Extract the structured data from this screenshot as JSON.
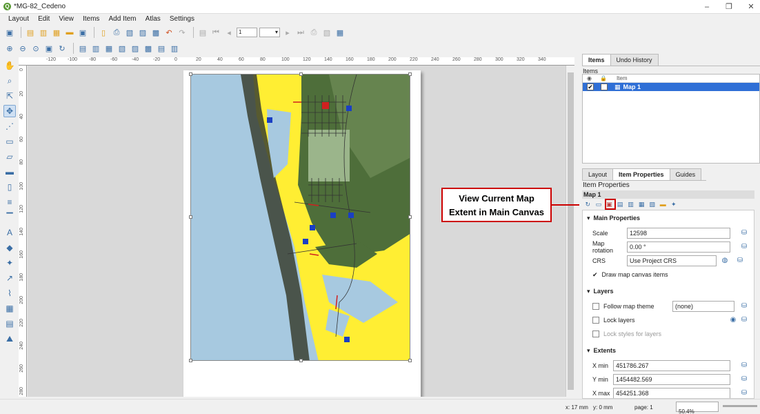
{
  "window": {
    "title": "*MG-82_Cedeno",
    "minimize": "–",
    "maximize": "❐",
    "close": "✕"
  },
  "menu": [
    "Layout",
    "Edit",
    "View",
    "Items",
    "Add Item",
    "Atlas",
    "Settings"
  ],
  "toolbar": {
    "page_spin": "1"
  },
  "ruler_h": [
    "-120",
    "-100",
    "-80",
    "-60",
    "-40",
    "-20",
    "0",
    "20",
    "40",
    "60",
    "80",
    "100",
    "120",
    "140",
    "160",
    "180",
    "200",
    "220",
    "240",
    "260",
    "280",
    "300",
    "320",
    "340"
  ],
  "ruler_v": [
    "0",
    "20",
    "40",
    "60",
    "80",
    "100",
    "120",
    "140",
    "160",
    "180",
    "200",
    "220",
    "240",
    "260",
    "280"
  ],
  "callout": {
    "line1": "View Current Map",
    "line2": "Extent in Main Canvas"
  },
  "panel": {
    "top_tabs": [
      "Items",
      "Undo History"
    ],
    "items_title": "Items",
    "items_header": "Item",
    "items": [
      {
        "name": "Map 1",
        "visible": true
      }
    ],
    "bottom_tabs": [
      "Layout",
      "Item Properties",
      "Guides"
    ],
    "props_title": "Item Properties",
    "props_item": "Map 1",
    "main_properties": {
      "header": "Main Properties",
      "scale_label": "Scale",
      "scale_value": "12598",
      "rotation_label": "Map rotation",
      "rotation_value": "0.00 °",
      "crs_label": "CRS",
      "crs_value": "Use Project CRS",
      "draw_items_label": "Draw map canvas items"
    },
    "layers": {
      "header": "Layers",
      "follow_theme_label": "Follow map theme",
      "theme_value": "(none)",
      "lock_layers_label": "Lock layers",
      "lock_styles_label": "Lock styles for layers"
    },
    "extents": {
      "header": "Extents",
      "xmin_label": "X min",
      "xmin_value": "451786.267",
      "ymin_label": "Y min",
      "ymin_value": "1454482.569",
      "xmax_label": "X max",
      "xmax_value": "454251.368"
    }
  },
  "status": {
    "x": "x: 17 mm",
    "y": "y: 0 mm",
    "page": "page: 1",
    "zoom": "50.4%"
  },
  "colors": {
    "accent": "#2f6fd6",
    "callout": "#cc0000",
    "sea": "#a7c9e0",
    "land": "#ffee33"
  }
}
